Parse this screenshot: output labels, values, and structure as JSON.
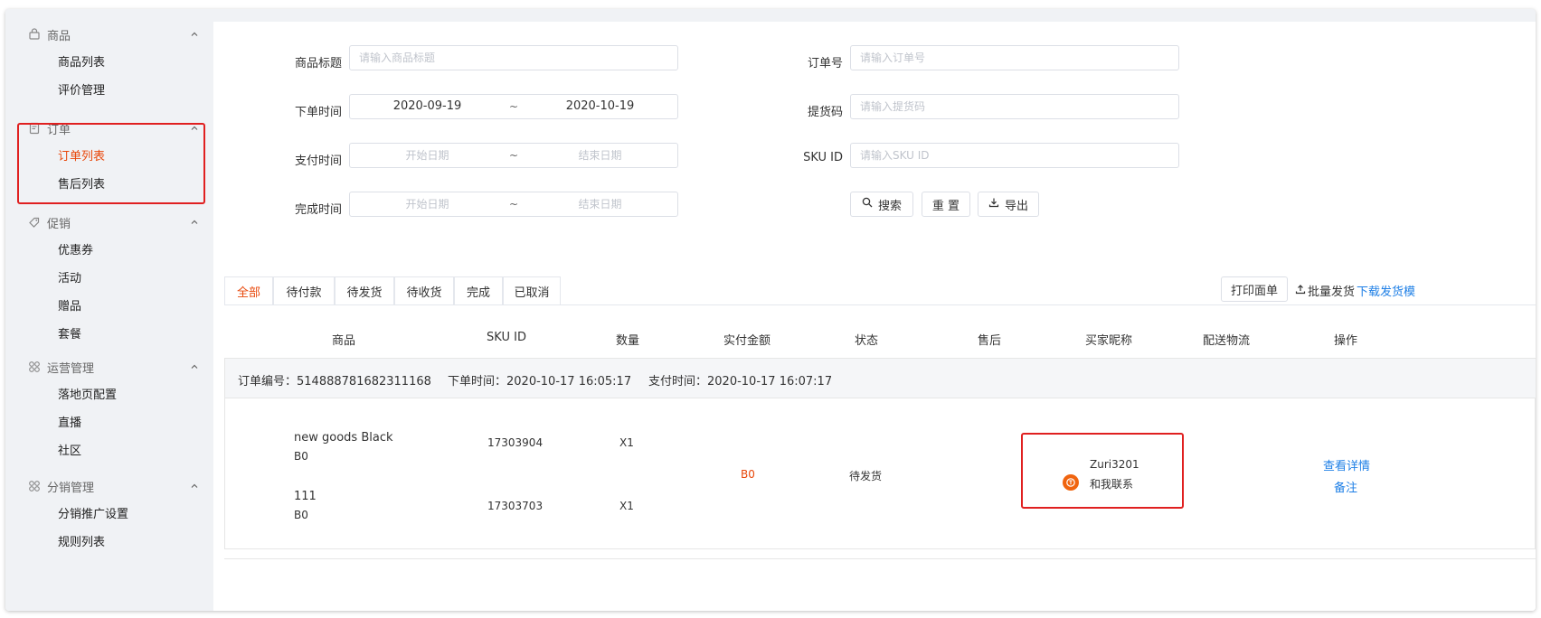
{
  "sidebar": {
    "groups": [
      {
        "label": "商品",
        "icon": "bag-icon",
        "items": [
          {
            "label": "商品列表"
          },
          {
            "label": "评价管理"
          }
        ]
      },
      {
        "label": "订单",
        "icon": "document-icon",
        "items": [
          {
            "label": "订单列表",
            "active": true
          },
          {
            "label": "售后列表"
          }
        ]
      },
      {
        "label": "促销",
        "icon": "tag-icon",
        "items": [
          {
            "label": "优惠券"
          },
          {
            "label": "活动"
          },
          {
            "label": "赠品"
          },
          {
            "label": "套餐"
          }
        ]
      },
      {
        "label": "运营管理",
        "icon": "grid-icon",
        "items": [
          {
            "label": "落地页配置"
          },
          {
            "label": "直播"
          },
          {
            "label": "社区"
          }
        ]
      },
      {
        "label": "分销管理",
        "icon": "grid-icon",
        "items": [
          {
            "label": "分销推广设置"
          },
          {
            "label": "规则列表"
          }
        ]
      }
    ]
  },
  "filters": {
    "product_title": {
      "label": "商品标题",
      "placeholder": "请输入商品标题"
    },
    "order_time": {
      "label": "下单时间",
      "start": "2020-09-19",
      "end": "2020-10-19",
      "sep": "~"
    },
    "pay_time": {
      "label": "支付时间",
      "start_placeholder": "开始日期",
      "end_placeholder": "结束日期",
      "sep": "~"
    },
    "finish_time": {
      "label": "完成时间",
      "start_placeholder": "开始日期",
      "end_placeholder": "结束日期",
      "sep": "~"
    },
    "order_no": {
      "label": "订单号",
      "placeholder": "请输入订单号"
    },
    "pickup_code": {
      "label": "提货码",
      "placeholder": "请输入提货码"
    },
    "sku_id": {
      "label": "SKU ID",
      "placeholder": "请输入SKU ID"
    },
    "buttons": {
      "search": "搜索",
      "reset": "重 置",
      "export": "导出"
    }
  },
  "tabs": [
    {
      "label": "全部",
      "active": true
    },
    {
      "label": "待付款"
    },
    {
      "label": "待发货"
    },
    {
      "label": "待收货"
    },
    {
      "label": "完成"
    },
    {
      "label": "已取消"
    }
  ],
  "toolbar": {
    "print": "打印面单",
    "bulk_ship": "批量发货",
    "download_template": "下载发货模"
  },
  "table": {
    "columns": [
      "商品",
      "SKU ID",
      "数量",
      "实付金额",
      "状态",
      "售后",
      "买家昵称",
      "配送物流",
      "操作"
    ]
  },
  "order": {
    "number_label": "订单编号：",
    "number": "514888781682311168",
    "order_time_label": "下单时间：",
    "order_time": "2020-10-17 16:05:17",
    "pay_time_label": "支付时间：",
    "pay_time": "2020-10-17 16:07:17",
    "items": [
      {
        "title": "new goods Black",
        "price": "B0",
        "sku": "17303904",
        "qty": "X1"
      },
      {
        "title": "111",
        "price": "B0",
        "sku": "17303703",
        "qty": "X1"
      }
    ],
    "paid_amount": "B0",
    "status": "待发货",
    "buyer": {
      "nickname": "Zuri3201",
      "contact": "和我联系"
    },
    "actions": {
      "details": "查看详情",
      "note": "备注"
    }
  },
  "colors": {
    "accent": "#e8470a",
    "link": "#1e7fe6",
    "highlight": "#e02020"
  }
}
